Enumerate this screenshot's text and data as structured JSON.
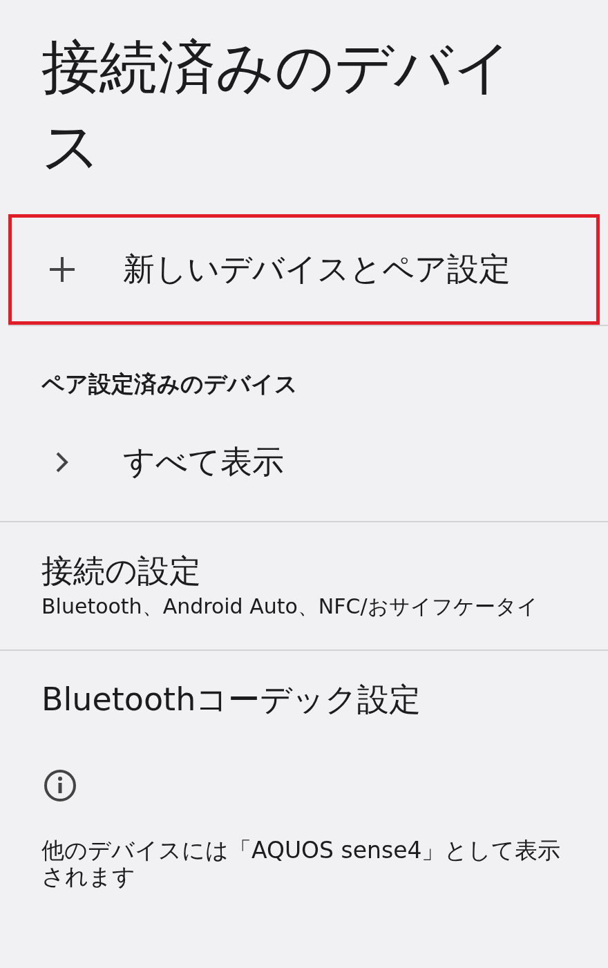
{
  "title": "接続済みのデバイス",
  "pair_new": {
    "label": "新しいデバイスとペア設定",
    "highlighted": true
  },
  "paired_header": "ペア設定済みのデバイス",
  "see_all": {
    "label": "すべて表示"
  },
  "settings": [
    {
      "title": "接続の設定",
      "summary": "Bluetooth、Android Auto、NFC/おサイフケータイ"
    },
    {
      "title": "Bluetoothコーデック設定"
    }
  ],
  "footer": "他のデバイスには「AQUOS sense4」として表示されます"
}
